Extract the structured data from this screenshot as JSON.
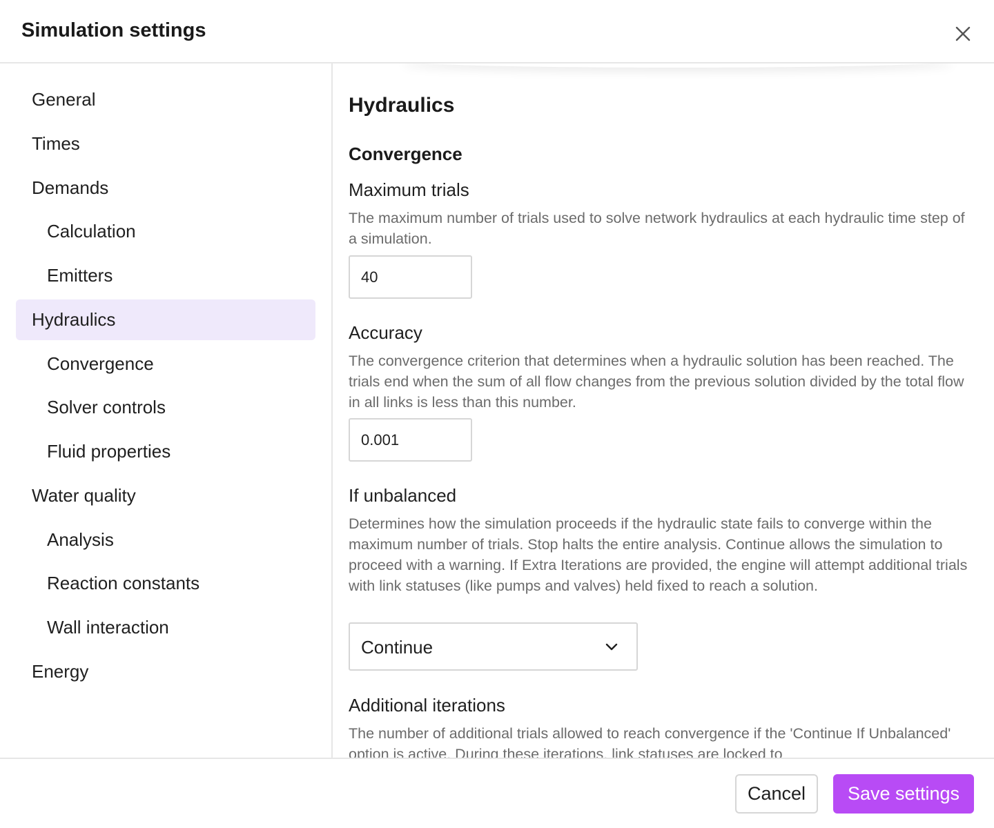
{
  "header": {
    "title": "Simulation settings",
    "close_icon": "close-icon"
  },
  "sidebar": {
    "items": [
      {
        "label": "General",
        "level": 1
      },
      {
        "label": "Times",
        "level": 1
      },
      {
        "label": "Demands",
        "level": 1
      },
      {
        "label": "Calculation",
        "level": 2
      },
      {
        "label": "Emitters",
        "level": 2
      },
      {
        "label": "Hydraulics",
        "level": 1,
        "active": true
      },
      {
        "label": "Convergence",
        "level": 2
      },
      {
        "label": "Solver controls",
        "level": 2
      },
      {
        "label": "Fluid properties",
        "level": 2
      },
      {
        "label": "Water quality",
        "level": 1
      },
      {
        "label": "Analysis",
        "level": 2
      },
      {
        "label": "Reaction constants",
        "level": 2
      },
      {
        "label": "Wall interaction",
        "level": 2
      },
      {
        "label": "Energy",
        "level": 1
      }
    ]
  },
  "main": {
    "section_title": "Hydraulics",
    "subsection_title": "Convergence",
    "max_trials": {
      "label": "Maximum trials",
      "description": "The maximum number of trials used to solve network hydraulics at each hydraulic time step of a simulation.",
      "value": "40"
    },
    "accuracy": {
      "label": "Accuracy",
      "description": "The convergence criterion that determines when a hydraulic solution has been reached. The trials end when the sum of all flow changes from the previous solution divided by the total flow in all links is less than this number.",
      "value": "0.001"
    },
    "if_unbalanced": {
      "label": "If unbalanced",
      "description": "Determines how the simulation proceeds if the hydraulic state fails to converge within the maximum number of trials. Stop halts the entire analysis. Continue allows the simulation to proceed with a warning. If Extra Iterations are provided, the engine will attempt additional trials with link statuses (like pumps and valves) held fixed to reach a solution.",
      "selected": "Continue",
      "chevron_icon": "chevron-down-icon"
    },
    "additional_iterations": {
      "label": "Additional iterations",
      "description": "The number of additional trials allowed to reach convergence if the 'Continue If Unbalanced' option is active. During these iterations, link statuses are locked to"
    }
  },
  "footer": {
    "cancel_label": "Cancel",
    "save_label": "Save settings"
  },
  "colors": {
    "accent": "#b84bf5",
    "active_nav_bg": "#efe9fb",
    "border": "#d6d6d6",
    "muted_text": "#6b6b6b"
  }
}
